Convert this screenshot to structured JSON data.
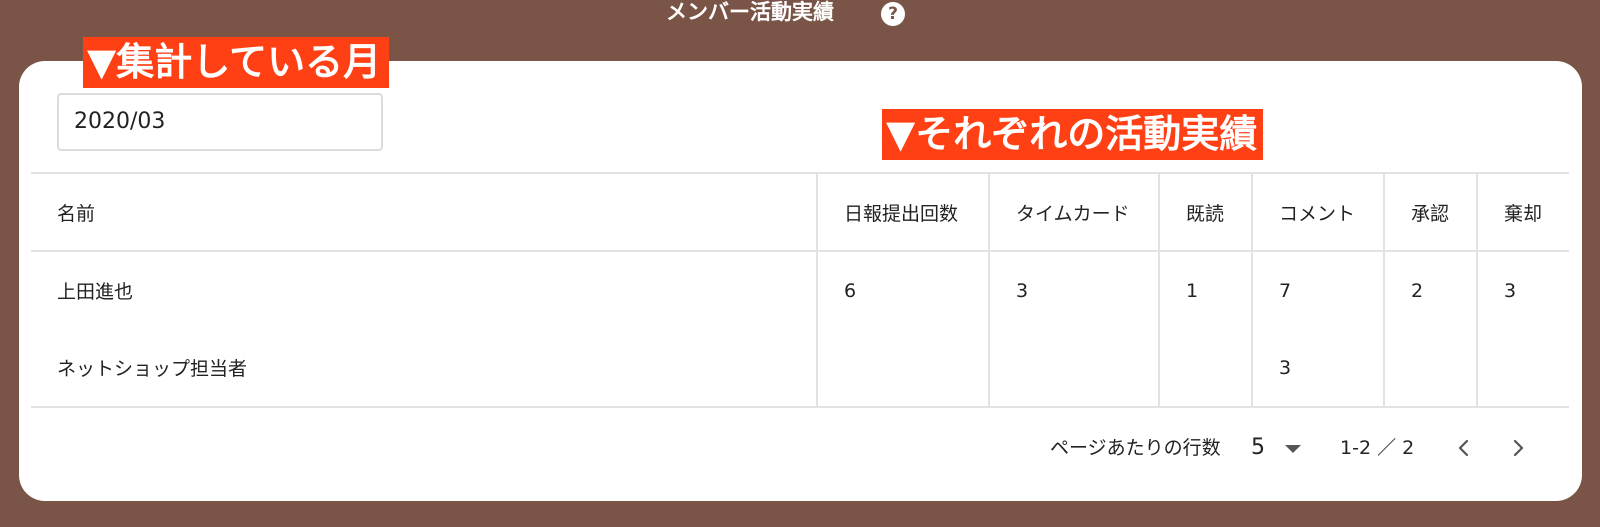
{
  "header": {
    "title": "メンバー活動実績",
    "help_icon": "?"
  },
  "annotations": {
    "month": "▼集計している月",
    "activity": "▼それぞれの活動実績"
  },
  "filter": {
    "month_value": "2020/03"
  },
  "table": {
    "columns": [
      "名前",
      "日報提出回数",
      "タイムカード",
      "既読",
      "コメント",
      "承認",
      "棄却"
    ],
    "rows": [
      {
        "name": "上田進也",
        "daily_reports": "6",
        "timecard": "3",
        "read": "1",
        "comment": "7",
        "approve": "2",
        "reject": "3"
      },
      {
        "name": "ネットショップ担当者",
        "daily_reports": "",
        "timecard": "",
        "read": "",
        "comment": "3",
        "approve": "",
        "reject": ""
      }
    ]
  },
  "pagination": {
    "rows_per_page_label": "ページあたりの行数",
    "rows_per_page": "5",
    "range": "1-2 ／ 2"
  },
  "colors": {
    "background": "#7a5547",
    "annotation": "#ff3f14",
    "card": "#ffffff"
  }
}
